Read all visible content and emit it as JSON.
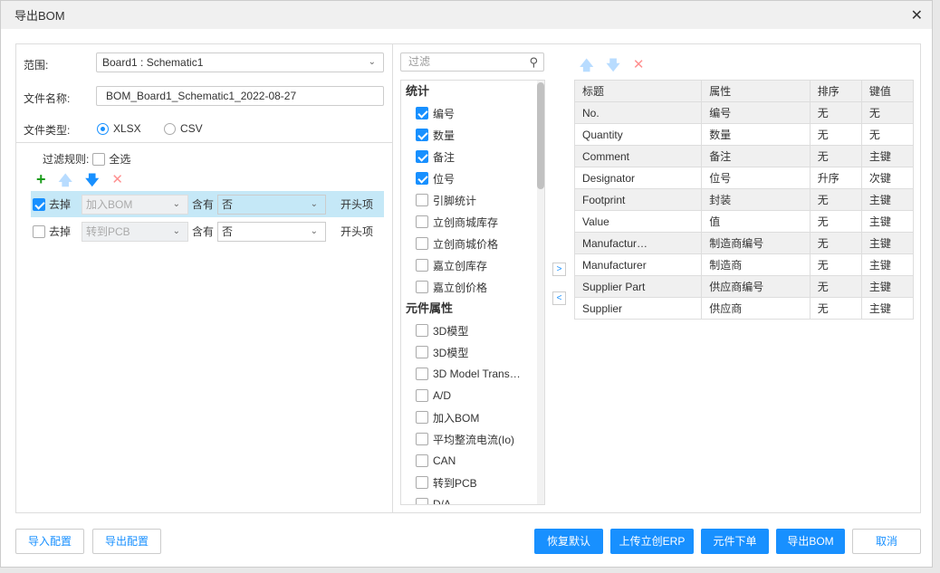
{
  "title": "导出BOM",
  "left": {
    "scope_label": "范围:",
    "scope_value": "Board1 : Schematic1",
    "filename_label": "文件名称:",
    "filename_value": "BOM_Board1_Schematic1_2022-08-27",
    "filetype_label": "文件类型:",
    "filetypes": [
      {
        "label": "XLSX",
        "selected": true
      },
      {
        "label": "CSV",
        "selected": false
      }
    ],
    "filter_rules_label": "过滤规则:",
    "select_all_label": "全选",
    "rules": [
      {
        "checked": true,
        "action": "去掉",
        "field": "加入BOM",
        "op": "含有",
        "value": "否",
        "mode": "开头项",
        "selected": true
      },
      {
        "checked": false,
        "action": "去掉",
        "field": "转到PCB",
        "op": "含有",
        "value": "否",
        "mode": "开头项",
        "selected": false
      }
    ]
  },
  "middle": {
    "search_placeholder": "过滤",
    "groups": [
      {
        "title": "统计",
        "items": [
          {
            "label": "编号",
            "checked": true
          },
          {
            "label": "数量",
            "checked": true
          },
          {
            "label": "备注",
            "checked": true
          },
          {
            "label": "位号",
            "checked": true
          },
          {
            "label": "引脚统计",
            "checked": false
          },
          {
            "label": "立创商城库存",
            "checked": false
          },
          {
            "label": "立创商城价格",
            "checked": false
          },
          {
            "label": "嘉立创库存",
            "checked": false
          },
          {
            "label": "嘉立创价格",
            "checked": false
          }
        ]
      },
      {
        "title": "元件属性",
        "items": [
          {
            "label": "3D模型",
            "checked": false
          },
          {
            "label": "3D模型",
            "checked": false
          },
          {
            "label": "3D Model Trans…",
            "checked": false
          },
          {
            "label": "A/D",
            "checked": false
          },
          {
            "label": "加入BOM",
            "checked": false
          },
          {
            "label": "平均整流电流(Io)",
            "checked": false
          },
          {
            "label": "CAN",
            "checked": false
          },
          {
            "label": "转到PCB",
            "checked": false
          },
          {
            "label": "D/A",
            "checked": false
          }
        ]
      }
    ]
  },
  "table": {
    "headers": [
      "标题",
      "属性",
      "排序",
      "键值"
    ],
    "rows": [
      [
        "No.",
        "编号",
        "无",
        "无"
      ],
      [
        "Quantity",
        "数量",
        "无",
        "无"
      ],
      [
        "Comment",
        "备注",
        "无",
        "主键"
      ],
      [
        "Designator",
        "位号",
        "升序",
        "次键"
      ],
      [
        "Footprint",
        "封装",
        "无",
        "主键"
      ],
      [
        "Value",
        "值",
        "无",
        "主键"
      ],
      [
        "Manufactur…",
        "制造商编号",
        "无",
        "主键"
      ],
      [
        "Manufacturer",
        "制造商",
        "无",
        "主键"
      ],
      [
        "Supplier Part",
        "供应商编号",
        "无",
        "主键"
      ],
      [
        "Supplier",
        "供应商",
        "无",
        "主键"
      ]
    ]
  },
  "buttons": {
    "import": "导入配置",
    "export_cfg": "导出配置",
    "restore": "恢复默认",
    "upload": "上传立创ERP",
    "order": "元件下单",
    "export": "导出BOM",
    "cancel": "取消"
  },
  "colors": {
    "primary": "#1890ff",
    "selected_row": "#c5e8f7",
    "add": "#1a9c1a",
    "delete": "#ff8080"
  }
}
